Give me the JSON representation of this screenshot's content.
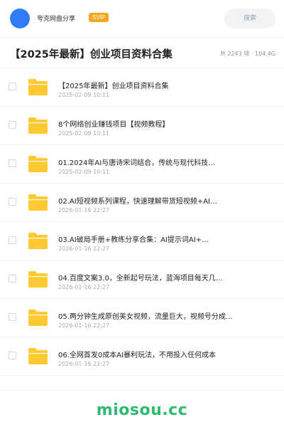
{
  "header": {
    "site_name": "夸克网盘分享",
    "badge": "SVIP",
    "search_label": "搜索"
  },
  "titlebar": {
    "title": "【2025年最新】创业项目资料合集",
    "meta": "共 2243 项 · 104.4G"
  },
  "items": [
    {
      "name": "【2025年最新】创业项目资料合集",
      "date": "2025-02-09 10:11"
    },
    {
      "name": "8个网络创业赚钱项目【视频教程】",
      "date": "2025-02-09 10:11"
    },
    {
      "name": "01.2024年AI与唐诗宋词结合，传统与现代科技…",
      "date": "2025-02-09 10:11"
    },
    {
      "name": "02.AI短视频系列课程，快速理解带货短视频+AI…",
      "date": "2026-01-16 22:27"
    },
    {
      "name": "03.AI破局手册+教练分享合集：AI提示词AI+…",
      "date": "2026-01-16 22:27"
    },
    {
      "name": "04.百度文案3.0，全新起号玩法，蓝海项目每天几…",
      "date": "2026-01-16 22:27"
    },
    {
      "name": "05.两分钟生成原创美女视频，流量巨大，视频号分成…",
      "date": "2026-01-16 22:27"
    },
    {
      "name": "06.全网首发0成本AI暴利玩法，不用投入任何成本",
      "date": "2026-01-16 22:27"
    }
  ],
  "watermark": "miosou.cc",
  "colors": {
    "avatar": "#2f7cf6",
    "badge": "#f5a623",
    "folder": "#ffc933",
    "watermark": "#2fbb6f"
  }
}
